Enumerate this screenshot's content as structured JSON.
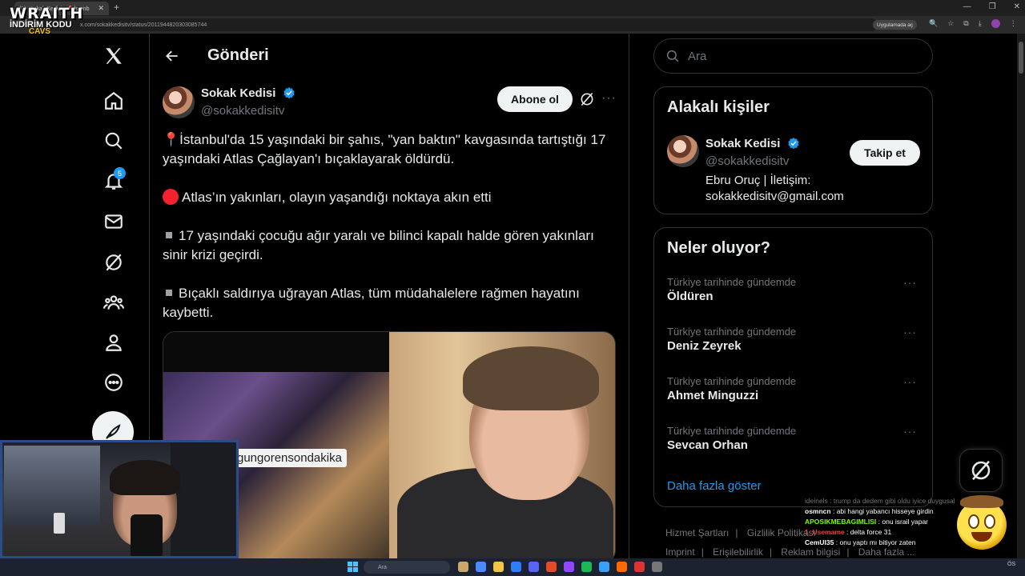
{
  "browser": {
    "tab_title": "(3) \"Sokak Kedisi - 📍İstanb",
    "tab_close": "✕",
    "new_tab": "+",
    "url": "x.com/sokakkedisitv/status/2011944820303085744",
    "app_chip": "Uygulamada aç",
    "window_controls": [
      "—",
      "❐",
      "✕"
    ]
  },
  "overlay": {
    "brand": "WRAITH",
    "line2": "İNDİRİM KODU",
    "line3": "CAVS"
  },
  "nav": {
    "notifications_badge": "5"
  },
  "header": {
    "title": "Gönderi"
  },
  "post": {
    "author_name": "Sokak Kedisi",
    "author_handle": "@sokakkedisitv",
    "subscribe_label": "Abone ol",
    "more": "···",
    "paragraphs": [
      "İstanbul'da 15 yaşındaki bir şahıs, \"yan baktın\" kavgasında tartıştığı 17 yaşındaki Atlas Çağlayan'ı bıçaklayarak öldürdü.",
      "Atlas’ın yakınları, olayın yaşandığı noktaya akın etti",
      "17 yaşındaki çocuğu ağır yaralı ve bilinci kapalı halde gören yakınları sinir krizi geçirdi.",
      "Bıçaklı saldırıya uğrayan Atlas, tüm müdahalelere rağmen hayatını kaybetti."
    ],
    "pin_emoji": "📍",
    "media_hashtag": "gungorensondakika"
  },
  "search": {
    "placeholder": "Ara"
  },
  "related": {
    "title": "Alakalı kişiler",
    "name": "Sokak Kedisi",
    "handle": "@sokakkedisitv",
    "bio_line1": "Ebru Oruç | İletişim:",
    "bio_line2": "sokakkedisitv@gmail.com",
    "follow_label": "Takip et"
  },
  "trends": {
    "title": "Neler oluyor?",
    "items": [
      {
        "context": "Türkiye tarihinde gündemde",
        "name": "Öldüren"
      },
      {
        "context": "Türkiye tarihinde gündemde",
        "name": "Deniz Zeyrek"
      },
      {
        "context": "Türkiye tarihinde gündemde",
        "name": "Ahmet Minguzzi"
      },
      {
        "context": "Türkiye tarihinde gündemde",
        "name": "Sevcan Orhan"
      }
    ],
    "more_dots": "···",
    "show_more": "Daha fazla göster"
  },
  "footer": {
    "links": [
      "Hizmet Şartları",
      "Gizlilik Politikası",
      "Imprint",
      "Erişilebilirlik",
      "Reklam bilgisi",
      "Daha fazla ..."
    ]
  },
  "chat": [
    {
      "user": "ideinels",
      "msg": ": trump da dedem gibi oldu iyice duygusal",
      "style": "faded"
    },
    {
      "user": "osmncn",
      "msg": ": abi hangi yabancı hisseye girdin",
      "style": "white"
    },
    {
      "user": "APOSIKMEBAGIMLISI",
      "msg": ": onu israil yapar",
      "style": "green"
    },
    {
      "user": "1_Usemame",
      "msg": ": delta force 31",
      "style": "red"
    },
    {
      "user": "CemUI35",
      "msg": ": onu yaptı mı bitiyor zaten",
      "style": "white"
    }
  ],
  "taskbar": {
    "search_placeholder": "Ara",
    "time": "ÖS"
  },
  "colors": {
    "accent": "#1d9bf0",
    "background": "#000000",
    "text": "#e7e9ea",
    "muted": "#71767b",
    "border": "#2f3336",
    "red": "#f4212e"
  }
}
